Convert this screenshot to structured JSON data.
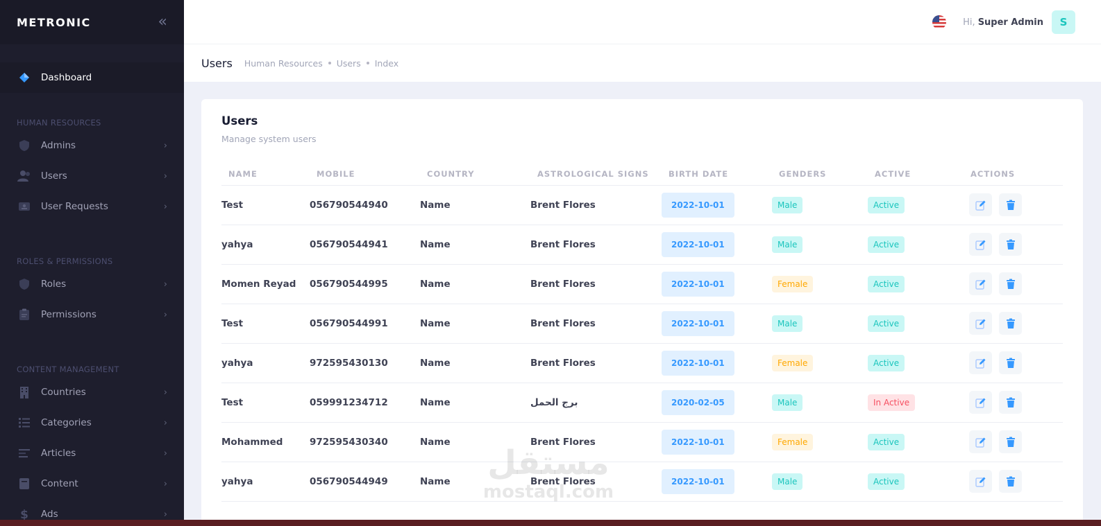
{
  "brand": {
    "name": "METRONIC",
    "collapse_icon": "double-chevron-left-icon"
  },
  "sidebar": {
    "dashboard": {
      "label": "Dashboard",
      "icon": "diamond-icon"
    },
    "sections": [
      {
        "title": "HUMAN RESOURCES",
        "items": [
          {
            "label": "Admins",
            "icon": "shield-icon"
          },
          {
            "label": "Users",
            "icon": "users-icon"
          },
          {
            "label": "User Requests",
            "icon": "id-card-icon"
          }
        ]
      },
      {
        "title": "ROLES & PERMISSIONS",
        "items": [
          {
            "label": "Roles",
            "icon": "shield-icon"
          },
          {
            "label": "Permissions",
            "icon": "clipboard-icon"
          }
        ]
      },
      {
        "title": "CONTENT MANAGEMENT",
        "items": [
          {
            "label": "Countries",
            "icon": "building-icon"
          },
          {
            "label": "Categories",
            "icon": "list-icon"
          },
          {
            "label": "Articles",
            "icon": "text-lines-icon"
          },
          {
            "label": "Content",
            "icon": "book-icon"
          },
          {
            "label": "Ads",
            "icon": "dollar-icon"
          }
        ]
      }
    ]
  },
  "header": {
    "greeting": "Hi,",
    "user_name": "Super Admin",
    "avatar_letter": "S",
    "flag": "us-flag-icon"
  },
  "subheader": {
    "title": "Users",
    "breadcrumbs": [
      "Human Resources",
      "Users",
      "Index"
    ]
  },
  "card": {
    "title": "Users",
    "subtitle": "Manage system users",
    "columns": [
      "NAME",
      "MOBILE",
      "COUNTRY",
      "ASTROLOGICAL SIGNS",
      "BIRTH DATE",
      "GENDERS",
      "ACTIVE",
      "ACTIONS"
    ],
    "rows": [
      {
        "name": "Test",
        "mobile": "056790544940",
        "country": "Name",
        "sign": "Brent Flores",
        "birth": "2022-10-01",
        "gender": "Male",
        "active": "Active"
      },
      {
        "name": "yahya",
        "mobile": "056790544941",
        "country": "Name",
        "sign": "Brent Flores",
        "birth": "2022-10-01",
        "gender": "Male",
        "active": "Active"
      },
      {
        "name": "Momen Reyad",
        "mobile": "056790544995",
        "country": "Name",
        "sign": "Brent Flores",
        "birth": "2022-10-01",
        "gender": "Female",
        "active": "Active"
      },
      {
        "name": "Test",
        "mobile": "056790544991",
        "country": "Name",
        "sign": "Brent Flores",
        "birth": "2022-10-01",
        "gender": "Male",
        "active": "Active"
      },
      {
        "name": "yahya",
        "mobile": "972595430130",
        "country": "Name",
        "sign": "Brent Flores",
        "birth": "2022-10-01",
        "gender": "Female",
        "active": "Active"
      },
      {
        "name": "Test",
        "mobile": "059991234712",
        "country": "Name",
        "sign": "برج الحمل",
        "birth": "2020-02-05",
        "gender": "Male",
        "active": "In Active"
      },
      {
        "name": "Mohammed",
        "mobile": "972595430340",
        "country": "Name",
        "sign": "Brent Flores",
        "birth": "2022-10-01",
        "gender": "Female",
        "active": "Active"
      },
      {
        "name": "yahya",
        "mobile": "056790544949",
        "country": "Name",
        "sign": "Brent Flores",
        "birth": "2022-10-01",
        "gender": "Male",
        "active": "Active"
      }
    ],
    "action_icons": [
      "edit-icon",
      "trash-icon"
    ]
  },
  "watermark": {
    "line1": "مستقل",
    "line2": "mostaql.com"
  },
  "colors": {
    "sidebar_bg": "#1e1e2d",
    "primary": "#3699ff",
    "success": "#1bc5bd",
    "warning": "#ffa800",
    "danger": "#f64e60"
  }
}
